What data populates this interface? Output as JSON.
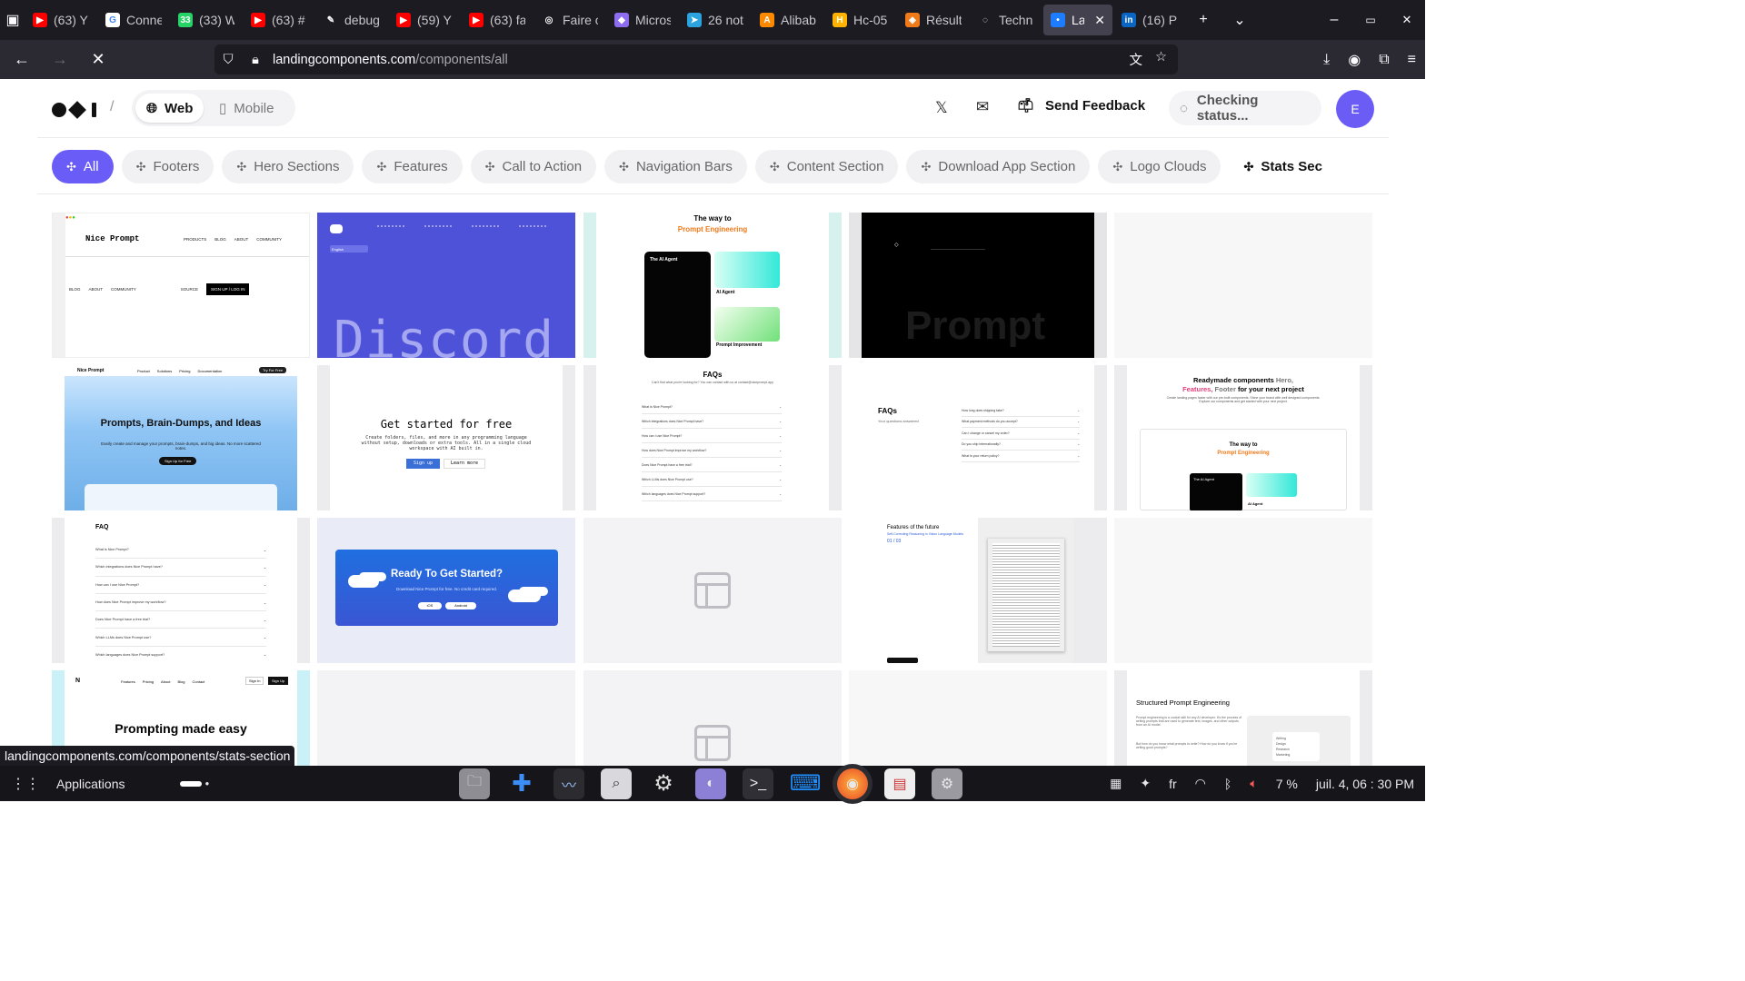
{
  "browser": {
    "tabs": [
      {
        "label": "(63) Y",
        "icon": "youtube-icon",
        "color": "#ff0000",
        "glyph": "▶"
      },
      {
        "label": "Conne",
        "icon": "google-icon",
        "color": "#ffffff",
        "glyph": "G"
      },
      {
        "label": "(33) W",
        "icon": "whatsapp-icon",
        "color": "#25d366",
        "glyph": "33"
      },
      {
        "label": "(63) #",
        "icon": "youtube-icon",
        "color": "#ff0000",
        "glyph": "▶"
      },
      {
        "label": "debug",
        "icon": "pen-icon",
        "color": "#1c1b22",
        "glyph": "✎"
      },
      {
        "label": "(59) Y",
        "icon": "youtube-icon",
        "color": "#ff0000",
        "glyph": "▶"
      },
      {
        "label": "(63) fa",
        "icon": "youtube-icon",
        "color": "#ff0000",
        "glyph": "▶"
      },
      {
        "label": "Faire c",
        "icon": "openai-icon",
        "color": "#1c1b22",
        "glyph": "◎"
      },
      {
        "label": "Micros",
        "icon": "copilot-icon",
        "color": "#8e6cf0",
        "glyph": "◆"
      },
      {
        "label": "26 not",
        "icon": "telegram-icon",
        "color": "#2aa3df",
        "glyph": "➤"
      },
      {
        "label": "Alibab",
        "icon": "alibaba-icon",
        "color": "#ff8a00",
        "glyph": "A"
      },
      {
        "label": "Hc-05",
        "icon": "bookmark-icon",
        "color": "#ffb300",
        "glyph": "H"
      },
      {
        "label": "Résult",
        "icon": "brave-icon",
        "color": "#f07a1a",
        "glyph": "◈"
      },
      {
        "label": "Techn",
        "icon": "ai-icon",
        "color": "#1c1b22",
        "glyph": "◌"
      },
      {
        "label": "Lan",
        "icon": "site-icon",
        "color": "#1e7cff",
        "glyph": "•",
        "active": true
      },
      {
        "label": "(16) P",
        "icon": "linkedin-icon",
        "color": "#0a66c2",
        "glyph": "in"
      }
    ],
    "new_tab": "+",
    "list_tabs": "⌄",
    "window_controls": [
      "–",
      "▭",
      "✕"
    ],
    "url_host": "landingcomponents.com",
    "url_path": "/components/all",
    "status_link": "landingcomponents.com/components/stats-section"
  },
  "header": {
    "slash": "/",
    "web_label": "Web",
    "mobile_label": "Mobile",
    "feedback_label": "Send Feedback",
    "status_label": "Checking status...",
    "avatar_initial": "E",
    "accent": "#6a5cf6"
  },
  "categories": [
    {
      "label": "All",
      "active": true
    },
    {
      "label": "Footers"
    },
    {
      "label": "Hero Sections"
    },
    {
      "label": "Features"
    },
    {
      "label": "Call to Action"
    },
    {
      "label": "Navigation Bars"
    },
    {
      "label": "Content Section"
    },
    {
      "label": "Download App Section"
    },
    {
      "label": "Logo Clouds"
    },
    {
      "label": "Stats Sec"
    }
  ],
  "cards": {
    "nav": {
      "brand": "Nice Prompt",
      "items": [
        "PRODUCTS",
        "BLOG",
        "ABOUT",
        "COMMUNITY"
      ],
      "items2": [
        "BLOG",
        "ABOUT",
        "COMMUNITY"
      ],
      "source": "SOURCE",
      "cta": "SIGN UP / LOG IN"
    },
    "discord": {
      "wordmark": "Discord",
      "lang": "English"
    },
    "prompt_eng": {
      "line1": "The way to",
      "line2": "Prompt Engineering",
      "agent": "The AI Agent",
      "agent2": "AI Agent",
      "improve": "Prompt Improvement"
    },
    "prompt_footer": {
      "wordmark": "Prompt"
    },
    "hero": {
      "brand": "Nice Prompt",
      "links": [
        "Product",
        "Solutions",
        "Pricing",
        "Documentation"
      ],
      "try": "Try For Free",
      "title": "Prompts, Brain-Dumps, and Ideas",
      "sub": "Easily create and manage your prompts, brain-dumps, and big ideas. No more scattered notes.",
      "cta": "Sign Up for Free"
    },
    "get_started": {
      "title": "Get started for free",
      "body": "Create folders, files, and more in any programming language without setup, downloads or extra tools. All in a single cloud workspace with AI built in.",
      "primary": "Sign up",
      "secondary": "Learn more"
    },
    "faq1": {
      "title": "FAQs",
      "sub": "Can't find what you're looking for? You can contact with us at contact@niceprompt.app",
      "questions": [
        "What is Nice Prompt?",
        "Which integrations does Nice Prompt have?",
        "How can I use Nice Prompt?",
        "How does Nice Prompt improve my workflow?",
        "Does Nice Prompt have a free trial?",
        "Which LLMs does Nice Prompt use?",
        "Which languages does Nice Prompt support?"
      ]
    },
    "faq2": {
      "title": "FAQs",
      "sub": "Your questions answered",
      "questions": [
        "How long does shipping take?",
        "What payment methods do you accept?",
        "Can I change or cancel my order?",
        "Do you ship internationally?",
        "What is your return policy?"
      ]
    },
    "readymade": {
      "line1": "Readymade components",
      "hero": "Hero,",
      "features": "Features,",
      "footer": "Footer",
      "rest": "for your next project",
      "body": "Create landing pages faster with our pre-built components. Shine your brand with well designed components. Explore our components and get started with your next project.",
      "inner1": "The way to",
      "inner2": "Prompt Engineering",
      "agent": "The AI Agent",
      "agent2": "AI Agent"
    },
    "faq3": {
      "title": "FAQ",
      "questions": [
        "What is Nice Prompt?",
        "Which integrations does Nice Prompt have?",
        "How can I use Nice Prompt?",
        "How does Nice Prompt improve my workflow?",
        "Does Nice Prompt have a free trial?",
        "Which LLMs does Nice Prompt use?",
        "Which languages does Nice Prompt support?"
      ]
    },
    "cta": {
      "title": "Ready To Get Started?",
      "sub": "Download Nice Prompt for free. No credit card required.",
      "ios": "iOS",
      "android": "Android"
    },
    "features_future": {
      "title": "Features of the future",
      "sub": "Self-Correcting Reasoning in Vision Language Models",
      "counter": "01 / 03"
    },
    "prompting": {
      "links": [
        "Features",
        "Pricing",
        "About",
        "Blog",
        "Contact"
      ],
      "signin": "Sign In",
      "signup": "Sign Up",
      "title": "Prompting made easy"
    },
    "structured": {
      "title": "Structured Prompt Engineering",
      "body": "Prompt engineering is a crucial skill for any AI developer. It's the process of writing prompts that are used to generate text, images, and other outputs from an AI model.",
      "body2": "But how do you know what prompts to write? How do you know if you're writing good prompts?",
      "list": [
        "Writing",
        "Design",
        "Research",
        "Marketing"
      ]
    }
  },
  "taskbar": {
    "applications": "Applications",
    "lang": "fr",
    "battery": "7 %",
    "clock": "juil. 4, 06 : 30 PM"
  }
}
